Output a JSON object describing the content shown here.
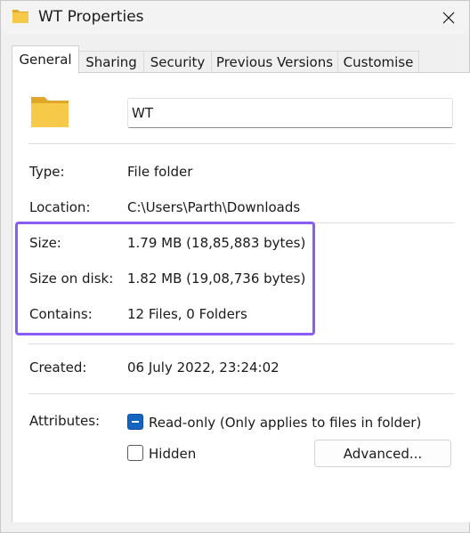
{
  "window": {
    "title": "WT Properties",
    "title_icon": "folder-icon",
    "close_icon": "close-icon"
  },
  "tabs": [
    {
      "label": "General",
      "active": true
    },
    {
      "label": "Sharing",
      "active": false
    },
    {
      "label": "Security",
      "active": false
    },
    {
      "label": "Previous Versions",
      "active": false
    },
    {
      "label": "Customise",
      "active": false
    }
  ],
  "general": {
    "folder_icon": "folder-icon",
    "name": "WT",
    "type_label": "Type:",
    "type_value": "File folder",
    "location_label": "Location:",
    "location_value": "C:\\Users\\Parth\\Downloads",
    "size_label": "Size:",
    "size_value": "1.79 MB (18,85,883 bytes)",
    "size_on_disk_label": "Size on disk:",
    "size_on_disk_value": "1.82 MB (19,08,736 bytes)",
    "contains_label": "Contains:",
    "contains_value": "12 Files, 0 Folders",
    "created_label": "Created:",
    "created_value": "06 July 2022, 23:24:02",
    "attributes_label": "Attributes:",
    "readonly_label": "Read-only (Only applies to files in folder)",
    "readonly_state": "indeterminate",
    "hidden_label": "Hidden",
    "hidden_checked": false,
    "advanced_button": "Advanced..."
  },
  "colors": {
    "highlight": "#8a5cf5",
    "checkbox_accent": "#1565c0",
    "folder": "#f7c948"
  }
}
